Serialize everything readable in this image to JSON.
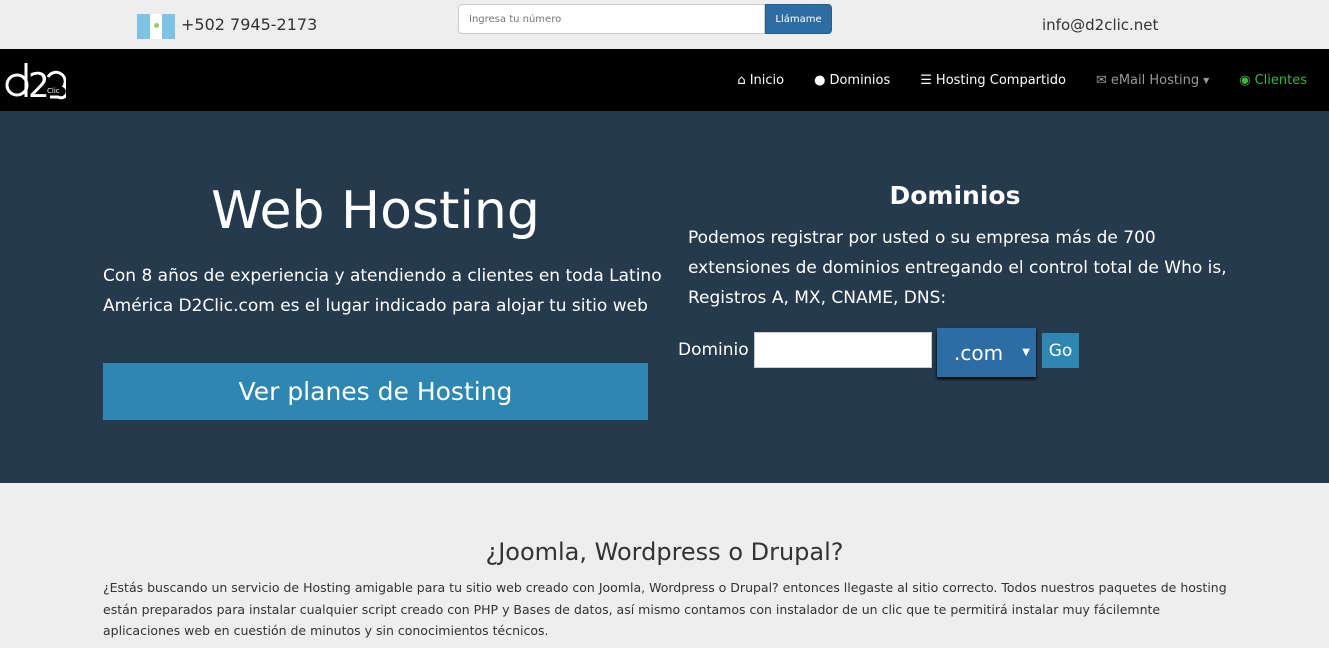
{
  "topbar": {
    "phone": "+502 7945-2173",
    "search_placeholder": "Ingresa tu número",
    "call_button": "Llámame",
    "email": "info@d2clic.net"
  },
  "nav": {
    "logo_text": "d2Clic",
    "items": [
      {
        "label": "Inicio",
        "icon": "home-icon"
      },
      {
        "label": "Dominios",
        "icon": "globe-icon"
      },
      {
        "label": "Hosting Compartido",
        "icon": "server-icon"
      },
      {
        "label": "eMail Hosting",
        "icon": "envelope-open-icon"
      },
      {
        "label": "Clientes",
        "icon": "user-circle-icon"
      }
    ]
  },
  "hero": {
    "title": "Web Hosting",
    "text": "Con 8 años de experiencia y atendiendo a clientes en toda Latino América D2Clic.com es el lugar indicado para alojar tu sitio web",
    "cta": "Ver planes de Hosting"
  },
  "domains": {
    "title": "Dominios",
    "text": "Podemos registrar por usted o su empresa más de 700 extensiones de dominios entregando el control total de Who is, Registros A, MX, CNAME, DNS:",
    "label": "Dominio",
    "input_value": "",
    "tld": ".com",
    "go": "Go"
  },
  "section": {
    "title": "¿Joomla, Wordpress o Drupal?",
    "text": "¿Estás buscando un servicio de Hosting amigable para tu sitio web creado con Joomla, Wordpress o Drupal? entonces llegaste al sitio correcto. Todos nuestros paquetes de hosting están preparados para instalar cualquier script creado con PHP y Bases de datos, así mismo contamos con instalador de un clic que te permitirá instalar muy fácilemnte aplicaciones web en cuestión de minutos y sin conocimientos técnicos."
  },
  "colors": {
    "hero_bg": "#263a4d",
    "accent": "#2e86b3",
    "nav_bg": "#000000",
    "clientes": "#3fb23f"
  }
}
